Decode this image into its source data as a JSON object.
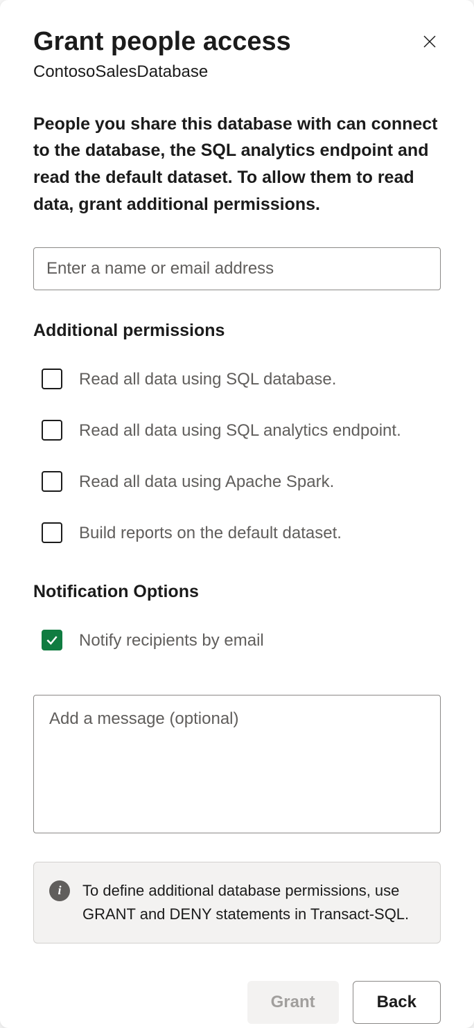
{
  "dialog": {
    "title": "Grant people access",
    "subtitle": "ContosoSalesDatabase",
    "description": "People you share this database with can connect to the database, the SQL analytics endpoint and read the default dataset. To allow them to read data, grant additional permissions.",
    "name_input": {
      "placeholder": "Enter a name or email address",
      "value": ""
    },
    "additional_permissions": {
      "heading": "Additional permissions",
      "options": [
        {
          "label": "Read all data using SQL database.",
          "checked": false
        },
        {
          "label": "Read all data using SQL analytics endpoint.",
          "checked": false
        },
        {
          "label": "Read all data using Apache Spark.",
          "checked": false
        },
        {
          "label": "Build reports on the default dataset.",
          "checked": false
        }
      ]
    },
    "notification": {
      "heading": "Notification Options",
      "notify": {
        "label": "Notify recipients by email",
        "checked": true
      },
      "message": {
        "placeholder": "Add a message (optional)",
        "value": ""
      }
    },
    "info_banner": "To define additional database permissions, use GRANT and DENY statements in Transact-SQL.",
    "buttons": {
      "grant": "Grant",
      "back": "Back"
    }
  }
}
